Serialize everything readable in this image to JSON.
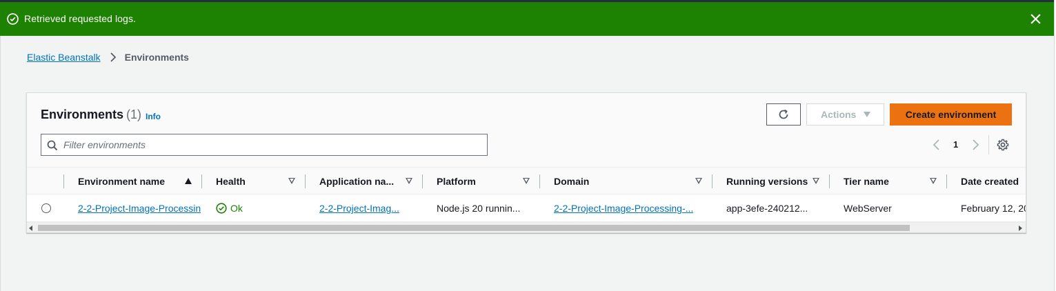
{
  "flash": {
    "message": "Retrieved requested logs.",
    "bg_color": "#1d8102",
    "icon": "check-circle-icon",
    "close_icon": "close-icon"
  },
  "breadcrumb": {
    "items": [
      "Elastic Beanstalk",
      "Environments"
    ]
  },
  "panel": {
    "title": "Environments",
    "count": "(1)",
    "info": "Info",
    "actions_label": "Actions",
    "create_label": "Create environment",
    "create_color": "#ec7211",
    "filter_placeholder": "Filter environments",
    "page": "1"
  },
  "table": {
    "columns": [
      "Environment name",
      "Health",
      "Application na...",
      "Platform",
      "Domain",
      "Running versions",
      "Tier name",
      "Date created"
    ],
    "sorted_column": "Environment name",
    "rows": [
      {
        "environment_name": "2-2-Project-Image-Processin",
        "health": "Ok",
        "application_name": "2-2-Project-Imag...",
        "platform": "Node.js 20 runnin...",
        "domain": "2-2-Project-Image-Processing-...",
        "running_versions": "app-3efe-240212...",
        "tier_name": "WebServer",
        "date_created": "February 12, 20"
      }
    ]
  }
}
